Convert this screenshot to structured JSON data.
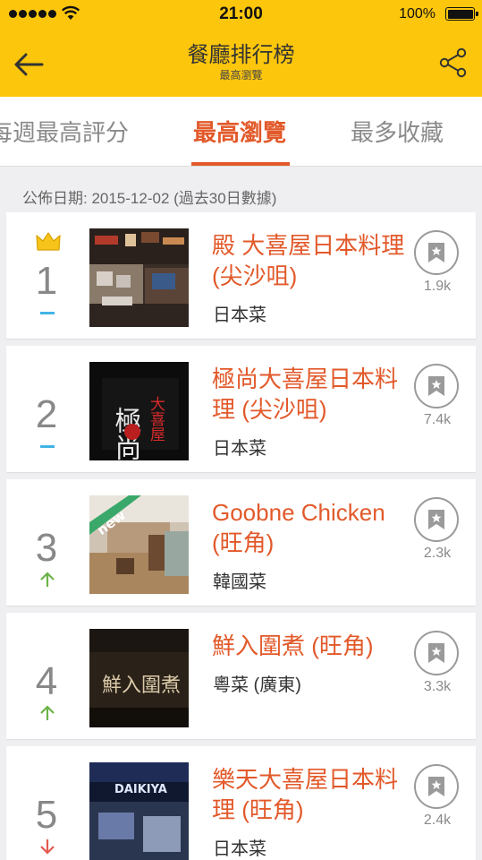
{
  "status": {
    "time": "21:00",
    "battery": "100%"
  },
  "header": {
    "title": "餐廳排行榜",
    "subtitle": "最高瀏覽"
  },
  "tabs": [
    {
      "label": "每週最高評分"
    },
    {
      "label": "最高瀏覽"
    },
    {
      "label": "最多收藏"
    }
  ],
  "published": "公佈日期: 2015-12-02 (過去30日數據)",
  "restaurants": [
    {
      "rank": "1",
      "name": "殿 大喜屋日本料理 (尖沙咀)",
      "cuisine": "日本菜",
      "bookmarks": "1.9k",
      "trend": "same",
      "crown": true
    },
    {
      "rank": "2",
      "name": "極尚大喜屋日本料理 (尖沙咀)",
      "cuisine": "日本菜",
      "bookmarks": "7.4k",
      "trend": "same",
      "thumb_sign": "極尚",
      "thumb_sign2": "大喜屋"
    },
    {
      "rank": "3",
      "name": "Goobne Chicken (旺角)",
      "cuisine": "韓國菜",
      "bookmarks": "2.3k",
      "trend": "up",
      "ribbon": "new"
    },
    {
      "rank": "4",
      "name": "鮮入圍煮 (旺角)",
      "cuisine": "粵菜 (廣東)",
      "bookmarks": "3.3k",
      "trend": "up",
      "thumb_sign": "鮮入圍煮"
    },
    {
      "rank": "5",
      "name": "樂天大喜屋日本料理 (旺角)",
      "cuisine": "日本菜",
      "bookmarks": "2.4k",
      "trend": "down",
      "thumb_sign": "DAIKIYA"
    }
  ],
  "colors": {
    "header": "#fcc60c",
    "accent": "#e2592a",
    "same": "#42b4e6",
    "up": "#6bb34a",
    "down": "#e35a4f"
  }
}
